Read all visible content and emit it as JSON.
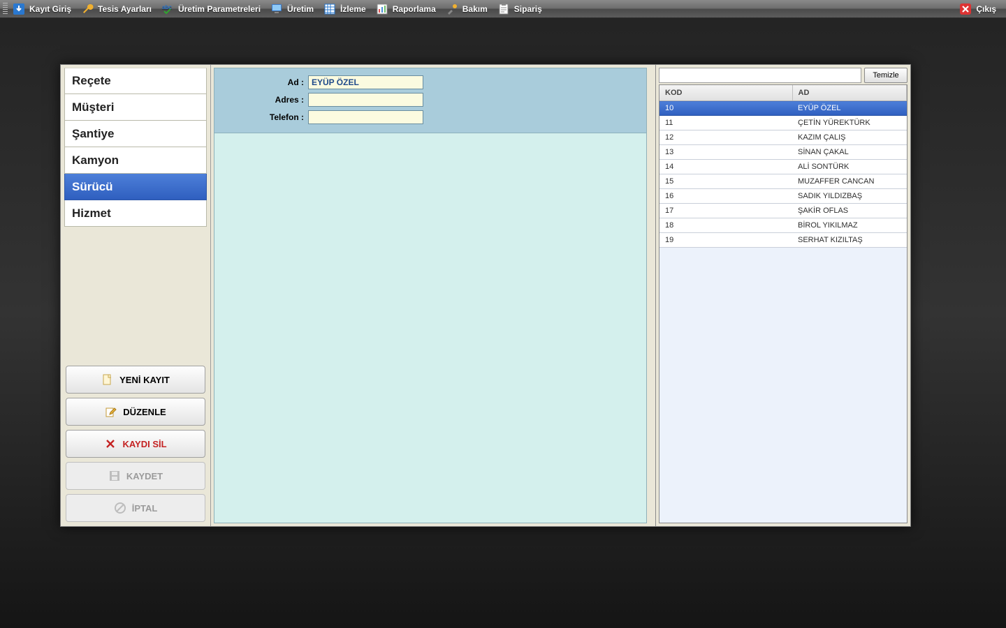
{
  "toolbar": {
    "items": [
      {
        "id": "kayit-giris",
        "label": "Kayıt Giriş"
      },
      {
        "id": "tesis-ayarlari",
        "label": "Tesis Ayarları"
      },
      {
        "id": "uretim-parametreleri",
        "label": "Üretim Parametreleri"
      },
      {
        "id": "uretim",
        "label": "Üretim"
      },
      {
        "id": "izleme",
        "label": "İzleme"
      },
      {
        "id": "raporlama",
        "label": "Raporlama"
      },
      {
        "id": "bakim",
        "label": "Bakım"
      },
      {
        "id": "siparis",
        "label": "Sipariş"
      }
    ],
    "exit_label": "Çıkış"
  },
  "nav": {
    "items": [
      {
        "id": "recete",
        "label": "Reçete",
        "selected": false
      },
      {
        "id": "musteri",
        "label": "Müşteri",
        "selected": false
      },
      {
        "id": "santiye",
        "label": "Şantiye",
        "selected": false
      },
      {
        "id": "kamyon",
        "label": "Kamyon",
        "selected": false
      },
      {
        "id": "surucu",
        "label": "Sürücü",
        "selected": true
      },
      {
        "id": "hizmet",
        "label": "Hizmet",
        "selected": false
      }
    ]
  },
  "crud": {
    "new_label": "YENİ KAYIT",
    "edit_label": "DÜZENLE",
    "delete_label": "KAYDI SİL",
    "save_label": "KAYDET",
    "cancel_label": "İPTAL"
  },
  "form": {
    "fields": {
      "ad_label": "Ad :",
      "ad_value": "EYÜP ÖZEL",
      "adres_label": "Adres :",
      "adres_value": "",
      "telefon_label": "Telefon :",
      "telefon_value": ""
    }
  },
  "list": {
    "search_value": "",
    "clear_label": "Temizle",
    "columns": {
      "kod": "KOD",
      "ad": "AD"
    },
    "rows": [
      {
        "kod": "10",
        "ad": "EYÜP ÖZEL",
        "selected": true
      },
      {
        "kod": "11",
        "ad": "ÇETİN YÜREKTÜRK"
      },
      {
        "kod": "12",
        "ad": "KAZIM ÇALIŞ"
      },
      {
        "kod": "13",
        "ad": "SİNAN ÇAKAL"
      },
      {
        "kod": "14",
        "ad": "ALİ SONTÜRK"
      },
      {
        "kod": "15",
        "ad": "MUZAFFER CANCAN"
      },
      {
        "kod": "16",
        "ad": "SADIK YILDIZBAŞ"
      },
      {
        "kod": "17",
        "ad": "ŞAKİR OFLAS"
      },
      {
        "kod": "18",
        "ad": "BİROL YIKILMAZ"
      },
      {
        "kod": "19",
        "ad": "SERHAT KIZILTAŞ"
      }
    ]
  }
}
